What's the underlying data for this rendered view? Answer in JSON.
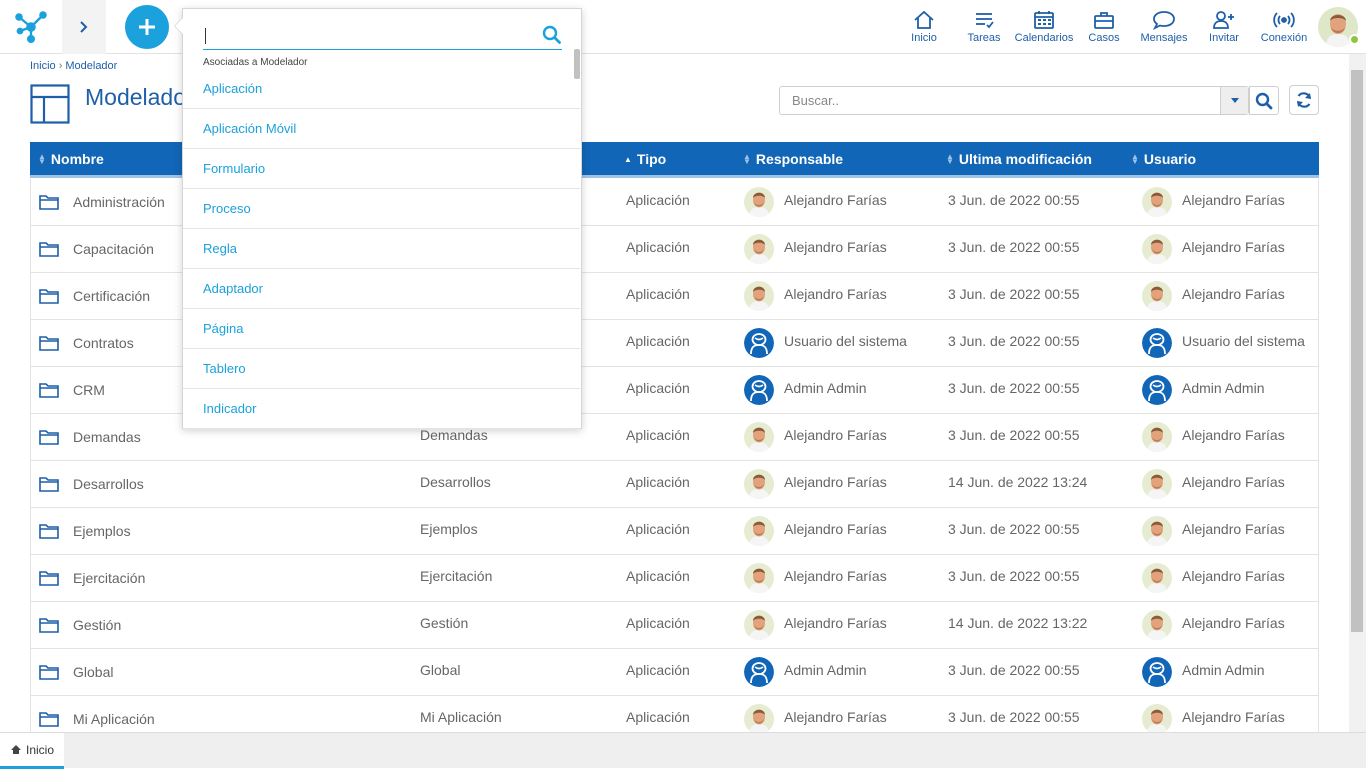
{
  "topbar": {
    "nav": [
      {
        "id": "inicio",
        "label": "Inicio",
        "icon": "home-icon"
      },
      {
        "id": "tareas",
        "label": "Tareas",
        "icon": "tasks-icon"
      },
      {
        "id": "calendarios",
        "label": "Calendarios",
        "icon": "calendar-icon"
      },
      {
        "id": "casos",
        "label": "Casos",
        "icon": "briefcase-icon"
      },
      {
        "id": "mensajes",
        "label": "Mensajes",
        "icon": "chat-icon"
      },
      {
        "id": "invitar",
        "label": "Invitar",
        "icon": "invite-user-icon"
      },
      {
        "id": "conexion",
        "label": "Conexión",
        "icon": "connection-icon"
      }
    ]
  },
  "breadcrumb": {
    "home": "Inicio",
    "separator": "›",
    "current": "Modelador"
  },
  "page": {
    "title": "Modelador"
  },
  "search": {
    "placeholder": "Buscar.."
  },
  "table": {
    "columns": {
      "nombre": "Nombre",
      "tipo": "Tipo",
      "responsable": "Responsable",
      "modificacion": "Ultima modificación",
      "usuario": "Usuario"
    },
    "rows": [
      {
        "nombre": "Administración",
        "descripcion": "",
        "tipo": "Aplicación",
        "responsable": "Alejandro Farías",
        "resp_avatar": "photo",
        "fecha": "3 Jun. de 2022 00:55",
        "usuario": "Alejandro Farías",
        "usr_avatar": "photo"
      },
      {
        "nombre": "Capacitación",
        "descripcion": "",
        "tipo": "Aplicación",
        "responsable": "Alejandro Farías",
        "resp_avatar": "photo",
        "fecha": "3 Jun. de 2022 00:55",
        "usuario": "Alejandro Farías",
        "usr_avatar": "photo"
      },
      {
        "nombre": "Certificación",
        "descripcion": "",
        "tipo": "Aplicación",
        "responsable": "Alejandro Farías",
        "resp_avatar": "photo",
        "fecha": "3 Jun. de 2022 00:55",
        "usuario": "Alejandro Farías",
        "usr_avatar": "photo"
      },
      {
        "nombre": "Contratos",
        "descripcion": "",
        "tipo": "Aplicación",
        "responsable": "Usuario del sistema",
        "resp_avatar": "system",
        "fecha": "3 Jun. de 2022 00:55",
        "usuario": "Usuario del sistema",
        "usr_avatar": "system"
      },
      {
        "nombre": "CRM",
        "descripcion": "",
        "tipo": "Aplicación",
        "responsable": "Admin Admin",
        "resp_avatar": "system",
        "fecha": "3 Jun. de 2022 00:55",
        "usuario": "Admin Admin",
        "usr_avatar": "system"
      },
      {
        "nombre": "Demandas",
        "descripcion": "Demandas",
        "tipo": "Aplicación",
        "responsable": "Alejandro Farías",
        "resp_avatar": "photo",
        "fecha": "3 Jun. de 2022 00:55",
        "usuario": "Alejandro Farías",
        "usr_avatar": "photo"
      },
      {
        "nombre": "Desarrollos",
        "descripcion": "Desarrollos",
        "tipo": "Aplicación",
        "responsable": "Alejandro Farías",
        "resp_avatar": "photo",
        "fecha": "14 Jun. de 2022 13:24",
        "usuario": "Alejandro Farías",
        "usr_avatar": "photo"
      },
      {
        "nombre": "Ejemplos",
        "descripcion": "Ejemplos",
        "tipo": "Aplicación",
        "responsable": "Alejandro Farías",
        "resp_avatar": "photo",
        "fecha": "3 Jun. de 2022 00:55",
        "usuario": "Alejandro Farías",
        "usr_avatar": "photo"
      },
      {
        "nombre": "Ejercitación",
        "descripcion": "Ejercitación",
        "tipo": "Aplicación",
        "responsable": "Alejandro Farías",
        "resp_avatar": "photo",
        "fecha": "3 Jun. de 2022 00:55",
        "usuario": "Alejandro Farías",
        "usr_avatar": "photo"
      },
      {
        "nombre": "Gestión",
        "descripcion": "Gestión",
        "tipo": "Aplicación",
        "responsable": "Alejandro Farías",
        "resp_avatar": "photo",
        "fecha": "14 Jun. de 2022 13:22",
        "usuario": "Alejandro Farías",
        "usr_avatar": "photo"
      },
      {
        "nombre": "Global",
        "descripcion": "Global",
        "tipo": "Aplicación",
        "responsable": "Admin Admin",
        "resp_avatar": "system",
        "fecha": "3 Jun. de 2022 00:55",
        "usuario": "Admin Admin",
        "usr_avatar": "system"
      },
      {
        "nombre": "Mi Aplicación",
        "descripcion": "Mi Aplicación",
        "tipo": "Aplicación",
        "responsable": "Alejandro Farías",
        "resp_avatar": "photo",
        "fecha": "3 Jun. de 2022 00:55",
        "usuario": "Alejandro Farías",
        "usr_avatar": "photo"
      }
    ]
  },
  "dropdown": {
    "search_value": "",
    "group_label": "Asociadas a Modelador",
    "items": [
      "Aplicación",
      "Aplicación Móvil",
      "Formulario",
      "Proceso",
      "Regla",
      "Adaptador",
      "Página",
      "Tablero",
      "Indicador"
    ]
  },
  "bottombar": {
    "tab_label": "Inicio"
  },
  "colors": {
    "primary": "#1266b7",
    "accent": "#1ba1db",
    "online": "#8dc63f"
  }
}
